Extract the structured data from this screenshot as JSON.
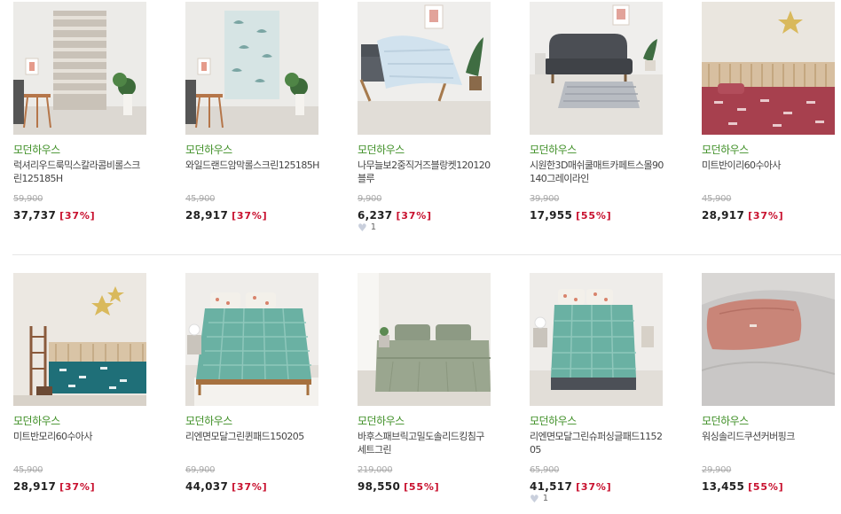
{
  "products": [
    {
      "brand": "모던하우스",
      "name": "럭셔리우드룩믹스칼라콤비롤스크린125185H",
      "original_price": "59,900",
      "price": "37,737",
      "discount": "[37%]",
      "likes": null
    },
    {
      "brand": "모던하우스",
      "name": "와일드랜드암막롤스크린125185H",
      "original_price": "45,900",
      "price": "28,917",
      "discount": "[37%]",
      "likes": null
    },
    {
      "brand": "모던하우스",
      "name": "나무늘보2중직거즈블랑켓120120블루",
      "original_price": "9,900",
      "price": "6,237",
      "discount": "[37%]",
      "likes": "1"
    },
    {
      "brand": "모던하우스",
      "name": "시원한3D매쉬쿨매트카페트스몰90140그레이라인",
      "original_price": "39,900",
      "price": "17,955",
      "discount": "[55%]",
      "likes": null
    },
    {
      "brand": "모던하우스",
      "name": "미트반이리60수아사",
      "original_price": "45,900",
      "price": "28,917",
      "discount": "[37%]",
      "likes": null
    },
    {
      "brand": "모던하우스",
      "name": "미트반모리60수아사",
      "original_price": "45,900",
      "price": "28,917",
      "discount": "[37%]",
      "likes": null
    },
    {
      "brand": "모던하우스",
      "name": "리엔면모달그린퀸패드150205",
      "original_price": "69,900",
      "price": "44,037",
      "discount": "[37%]",
      "likes": null
    },
    {
      "brand": "모던하우스",
      "name": "바후스패브릭고밀도솔리드킹침구세트그린",
      "original_price": "219,000",
      "price": "98,550",
      "discount": "[55%]",
      "likes": null
    },
    {
      "brand": "모던하우스",
      "name": "리엔면모달그린슈퍼싱글패드115205",
      "original_price": "65,900",
      "price": "41,517",
      "discount": "[37%]",
      "likes": "1"
    },
    {
      "brand": "모던하우스",
      "name": "워싱솔리드쿠션커버핑크",
      "original_price": "29,900",
      "price": "13,455",
      "discount": "[55%]",
      "likes": null
    }
  ],
  "colors": {
    "brand": "#3f8f26",
    "discount": "#c8102e",
    "price": "#222222"
  },
  "icons": {
    "like": "heart-icon"
  }
}
